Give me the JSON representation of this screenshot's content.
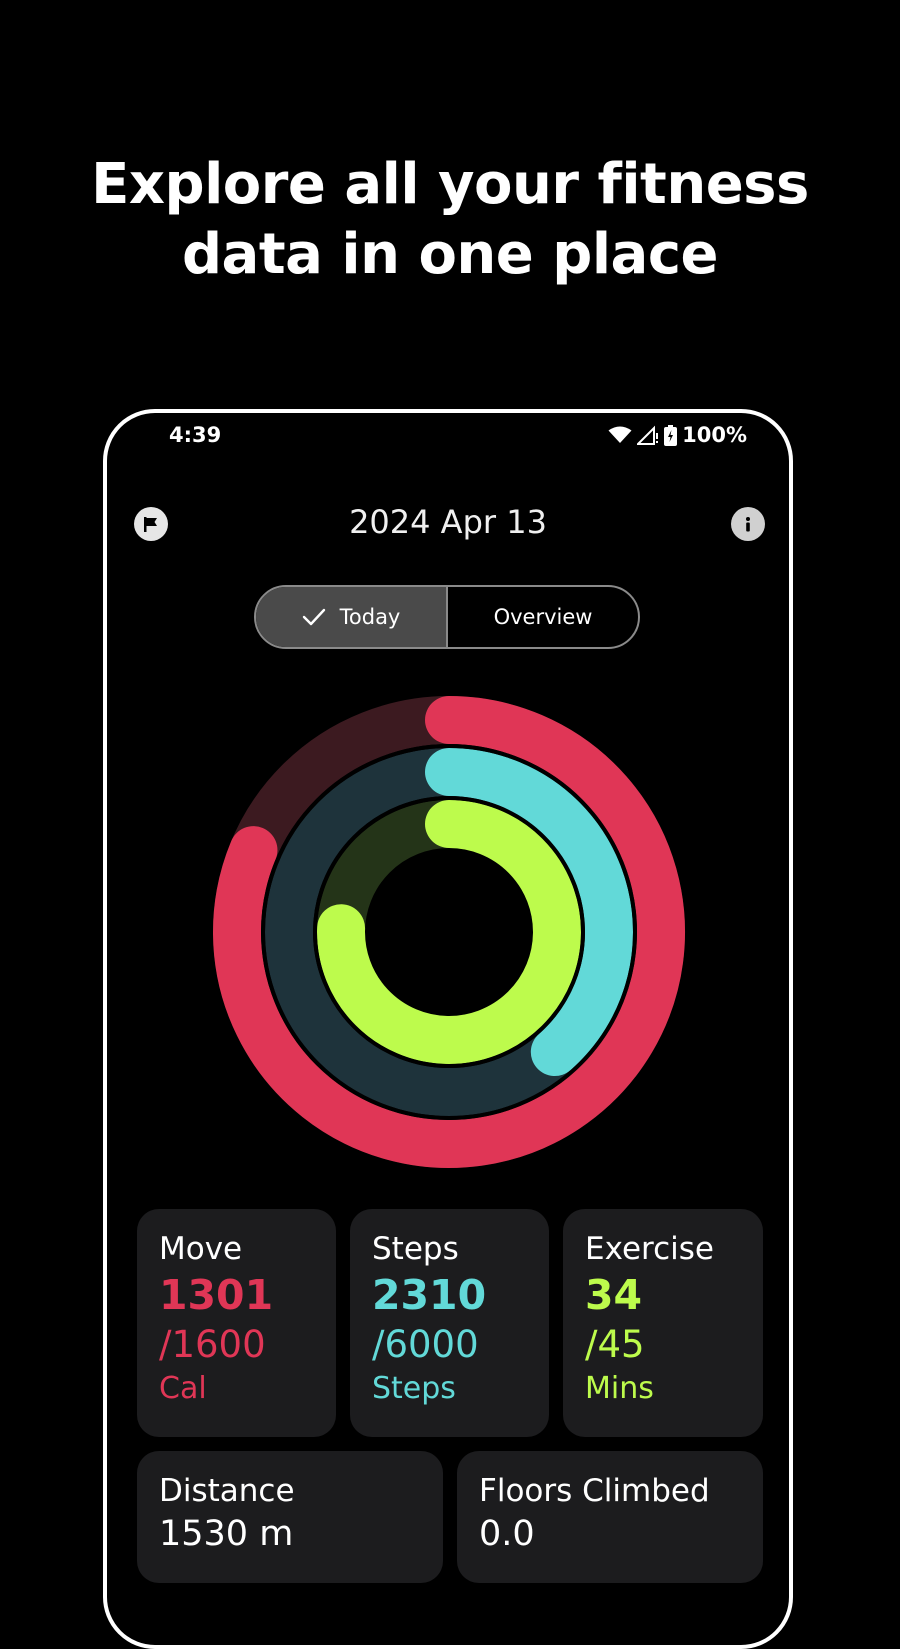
{
  "headline": {
    "line1": "Explore all your fitness",
    "line2": "data in one place"
  },
  "status_bar": {
    "time": "4:39",
    "battery": "100%"
  },
  "header": {
    "date": "2024 Apr 13",
    "flag_icon": "flag-icon",
    "info_icon": "info-icon"
  },
  "tabs": [
    {
      "label": "Today",
      "selected": true
    },
    {
      "label": "Overview",
      "selected": false
    }
  ],
  "rings": {
    "move": {
      "value": 1301,
      "goal": 1600,
      "color": "#e03656",
      "track": "#3c1a20"
    },
    "steps": {
      "value": 2310,
      "goal": 6000,
      "color": "#62d9d8",
      "track": "#1e333b"
    },
    "exercise": {
      "value": 34,
      "goal": 45,
      "color": "#bdfb4c",
      "track": "#243418"
    }
  },
  "cards": {
    "move": {
      "label": "Move",
      "value": "1301",
      "goal": "/1600",
      "unit": "Cal",
      "color": "#e03656"
    },
    "steps": {
      "label": "Steps",
      "value": "2310",
      "goal": "/6000",
      "unit": "Steps",
      "color": "#62d9d8"
    },
    "exercise": {
      "label": "Exercise",
      "value": "34",
      "goal": "/45",
      "unit": "Mins",
      "color": "#bdfb4c"
    },
    "distance": {
      "label": "Distance",
      "value": "1530 m"
    },
    "floors": {
      "label": "Floors Climbed",
      "value": "0.0"
    }
  }
}
